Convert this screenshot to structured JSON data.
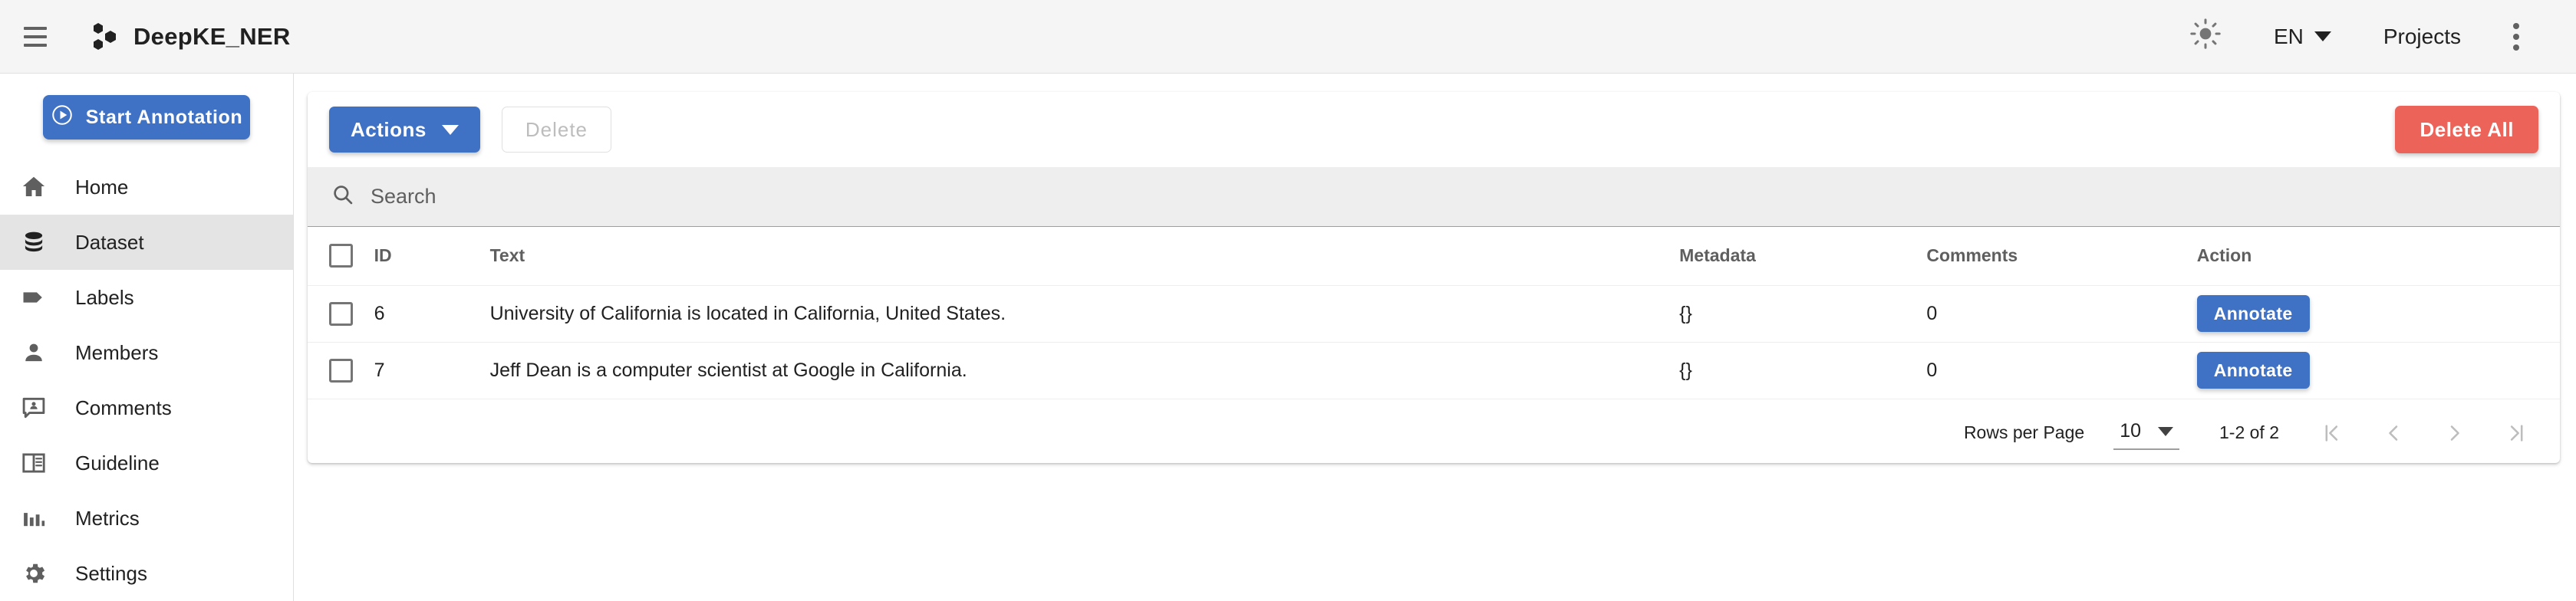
{
  "header": {
    "menu_icon": "hamburger-icon",
    "logo_icon": "deepke-logo-icon",
    "title": "DeepKE_NER",
    "theme_icon": "sun-icon",
    "language": "EN",
    "projects_label": "Projects",
    "more_icon": "kebab-menu-icon"
  },
  "sidebar": {
    "start_annotation_label": "Start Annotation",
    "items": [
      {
        "label": "Home",
        "icon": "home-icon",
        "active": false
      },
      {
        "label": "Dataset",
        "icon": "database-icon",
        "active": true
      },
      {
        "label": "Labels",
        "icon": "tag-icon",
        "active": false
      },
      {
        "label": "Members",
        "icon": "person-icon",
        "active": false
      },
      {
        "label": "Comments",
        "icon": "comment-icon",
        "active": false
      },
      {
        "label": "Guideline",
        "icon": "book-icon",
        "active": false
      },
      {
        "label": "Metrics",
        "icon": "bar-chart-icon",
        "active": false
      },
      {
        "label": "Settings",
        "icon": "gear-icon",
        "active": false
      }
    ]
  },
  "toolbar": {
    "actions_label": "Actions",
    "delete_label": "Delete",
    "delete_all_label": "Delete All"
  },
  "search": {
    "placeholder": "Search",
    "value": "",
    "icon": "search-icon"
  },
  "table": {
    "columns": [
      "ID",
      "Text",
      "Metadata",
      "Comments",
      "Action"
    ],
    "rows": [
      {
        "id": "6",
        "text": "University of California is located in California, United States.",
        "metadata": "{}",
        "comments": "0",
        "action_label": "Annotate",
        "checked": false
      },
      {
        "id": "7",
        "text": "Jeff Dean is a computer scientist at Google in California.",
        "metadata": "{}",
        "comments": "0",
        "action_label": "Annotate",
        "checked": false
      }
    ]
  },
  "pagination": {
    "rows_per_page_label": "Rows per Page",
    "rows_per_page_value": "10",
    "range_label": "1-2 of 2",
    "first_icon": "first-page-icon",
    "prev_icon": "prev-page-icon",
    "next_icon": "next-page-icon",
    "last_icon": "last-page-icon"
  },
  "colors": {
    "primary": "#3f72c4",
    "danger": "#ec6459",
    "header_bg": "#f5f5f5",
    "active_nav_bg": "#e4e4e4",
    "search_bg": "#eeeeee"
  }
}
